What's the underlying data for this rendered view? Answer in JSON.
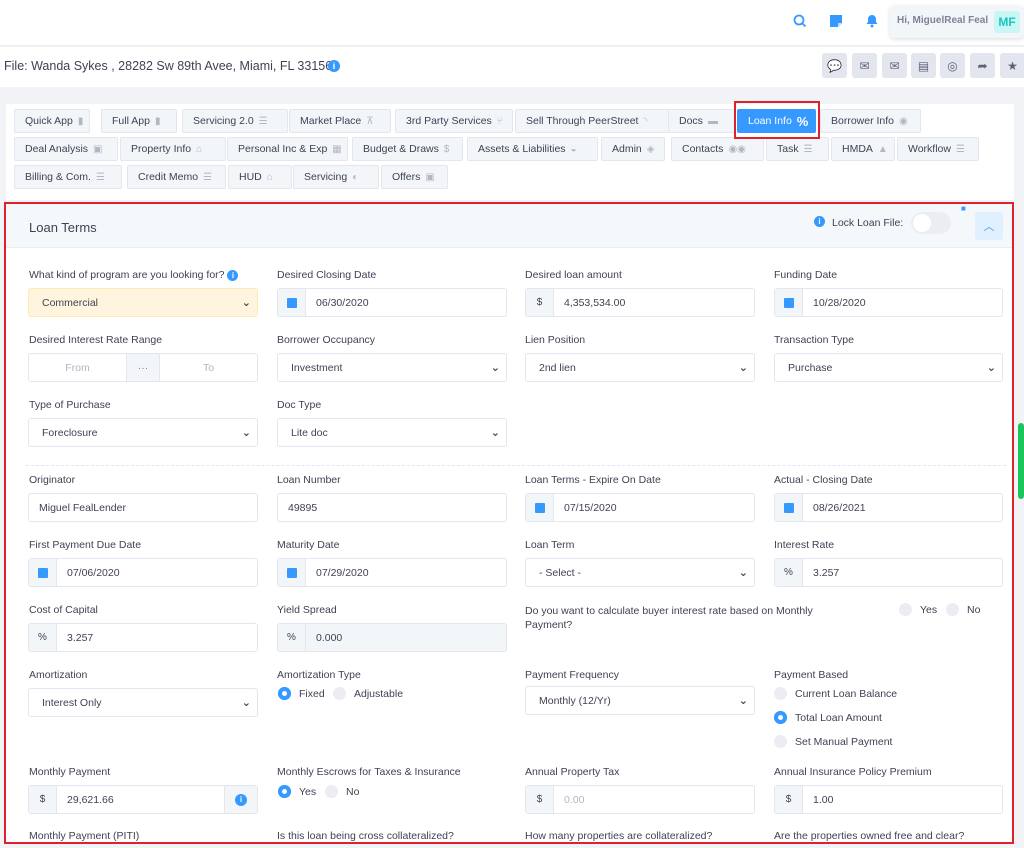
{
  "header": {
    "greeting": "Hi, MiguelReal Feal",
    "avatar_initials": "MF",
    "accent_color": "#3699ff"
  },
  "file": {
    "title": "File: Wanda Sykes , 28282 Sw 89th Avee, Miami, FL 33156"
  },
  "tabs": [
    {
      "label": "Quick App",
      "icon": "file-icon"
    },
    {
      "label": "Full App",
      "icon": "file-icon"
    },
    {
      "label": "Servicing 2.0",
      "icon": "list-icon"
    },
    {
      "label": "Market Place",
      "icon": "cart-icon"
    },
    {
      "label": "3rd Party Services",
      "icon": "branch-icon"
    },
    {
      "label": "Sell Through PeerStreet",
      "icon": "rss-icon"
    },
    {
      "label": "Docs",
      "icon": "folder-icon"
    },
    {
      "label": "Loan Info",
      "icon": "percent-icon",
      "active": true
    },
    {
      "label": "Borrower Info",
      "icon": "user-icon"
    },
    {
      "label": "Deal Analysis",
      "icon": "gift-icon"
    },
    {
      "label": "Property Info",
      "icon": "home-icon"
    },
    {
      "label": "Personal Inc & Exp",
      "icon": "calculator-icon"
    },
    {
      "label": "Budget & Draws",
      "icon": "dollar-icon"
    },
    {
      "label": "Assets & Liabilities",
      "icon": "hand-icon"
    },
    {
      "label": "Admin",
      "icon": "shield-icon"
    },
    {
      "label": "Contacts",
      "icon": "users-icon"
    },
    {
      "label": "Task",
      "icon": "checklist-icon"
    },
    {
      "label": "HMDA",
      "icon": "building-icon"
    },
    {
      "label": "Workflow",
      "icon": "checklist-icon"
    },
    {
      "label": "Billing & Com.",
      "icon": "list-icon"
    },
    {
      "label": "Credit Memo",
      "icon": "list-icon"
    },
    {
      "label": "HUD",
      "icon": "home-icon"
    },
    {
      "label": "Servicing",
      "icon": "handshake-icon"
    },
    {
      "label": "Offers",
      "icon": "gift-icon"
    }
  ],
  "panel": {
    "title": "Loan Terms",
    "lock_label": "Lock Loan File:"
  },
  "fields": {
    "program": {
      "label": "What kind of program are you looking for?",
      "value": "Commercial"
    },
    "desired_closing": {
      "label": "Desired Closing Date",
      "value": "06/30/2020"
    },
    "desired_amount": {
      "label": "Desired loan amount",
      "prefix": "$",
      "value": "4,353,534.00"
    },
    "funding_date": {
      "label": "Funding Date",
      "value": "10/28/2020"
    },
    "rate_range": {
      "label": "Desired Interest Rate Range",
      "from": "From",
      "to": "To",
      "mid": "···"
    },
    "occupancy": {
      "label": "Borrower Occupancy",
      "value": "Investment"
    },
    "lien": {
      "label": "Lien Position",
      "value": "2nd lien"
    },
    "transaction": {
      "label": "Transaction Type",
      "value": "Purchase"
    },
    "purchase_type": {
      "label": "Type of Purchase",
      "value": "Foreclosure"
    },
    "doc_type": {
      "label": "Doc Type",
      "value": "Lite doc"
    },
    "originator": {
      "label": "Originator",
      "value": "Miguel FealLender"
    },
    "loan_number": {
      "label": "Loan Number",
      "value": "49895"
    },
    "terms_expire": {
      "label": "Loan Terms - Expire On Date",
      "value": "07/15/2020"
    },
    "actual_closing": {
      "label": "Actual - Closing Date",
      "value": "08/26/2021"
    },
    "first_payment": {
      "label": "First Payment Due Date",
      "value": "07/06/2020"
    },
    "maturity": {
      "label": "Maturity Date",
      "value": "07/29/2020"
    },
    "loan_term": {
      "label": "Loan Term",
      "value": "- Select -"
    },
    "interest_rate": {
      "label": "Interest Rate",
      "prefix": "%",
      "value": "3.257"
    },
    "cost_capital": {
      "label": "Cost of Capital",
      "prefix": "%",
      "value": "3.257"
    },
    "yield_spread": {
      "label": "Yield Spread",
      "prefix": "%",
      "value": "0.000"
    },
    "buyer_rate": {
      "label": "Do you want to calculate buyer interest rate based on Monthly Payment?",
      "yes": "Yes",
      "no": "No"
    },
    "amortization": {
      "label": "Amortization",
      "value": "Interest Only"
    },
    "amort_type": {
      "label": "Amortization Type",
      "opt1": "Fixed",
      "opt2": "Adjustable"
    },
    "pay_freq": {
      "label": "Payment Frequency",
      "value": "Monthly (12/Yr)"
    },
    "pay_based": {
      "label": "Payment Based",
      "opt1": "Current Loan Balance",
      "opt2": "Total Loan Amount",
      "opt3": "Set Manual Payment"
    },
    "monthly_payment": {
      "label": "Monthly Payment",
      "prefix": "$",
      "value": "29,621.66"
    },
    "escrows": {
      "label": "Monthly Escrows for Taxes & Insurance",
      "yes": "Yes",
      "no": "No"
    },
    "property_tax": {
      "label": "Annual Property Tax",
      "prefix": "$",
      "placeholder": "0.00"
    },
    "insurance": {
      "label": "Annual Insurance Policy Premium",
      "prefix": "$",
      "value": "1.00"
    },
    "piti": {
      "label": "Monthly Payment (PITI)"
    },
    "cross_coll": {
      "label": "Is this loan being cross collateralized?"
    },
    "how_many": {
      "label": "How many properties are collateralized?"
    },
    "free_clear": {
      "label": "Are the properties owned free and clear?"
    }
  }
}
